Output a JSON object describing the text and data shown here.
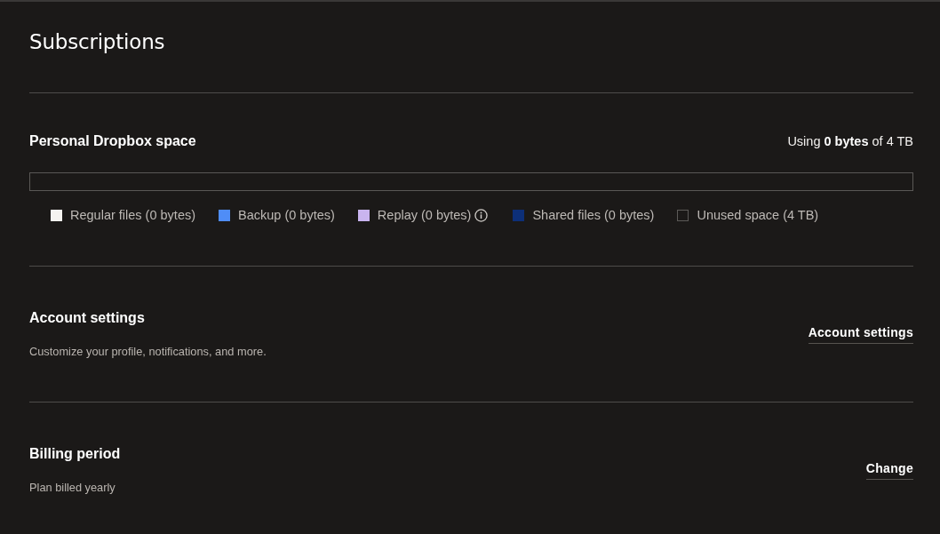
{
  "page": {
    "title": "Subscriptions"
  },
  "storage": {
    "title": "Personal Dropbox space",
    "usage": "Using **0 bytes** of 4 TB",
    "level": 0,
    "legend": [
      {
        "label": "Regular files (0 bytes)",
        "kind": "filled",
        "color": "#f5f3f0",
        "info": false
      },
      {
        "label": "Backup (0 bytes)",
        "kind": "filled",
        "color": "#4f8df7",
        "info": false
      },
      {
        "label": "Replay (0 bytes)",
        "kind": "filled",
        "color": "#c9b4ef",
        "info": true
      },
      {
        "label": "Shared files (0 bytes)",
        "kind": "filled",
        "color": "#0d2f78",
        "info": false
      },
      {
        "label": "Unused space (4 TB)",
        "kind": "empty",
        "info": false
      }
    ]
  },
  "sections": [
    {
      "title": "Account settings",
      "description": "Customize your profile, notifications, and more.",
      "action": "Account settings"
    },
    {
      "title": "Billing period",
      "description": "Plan billed yearly",
      "action": "Change"
    }
  ]
}
